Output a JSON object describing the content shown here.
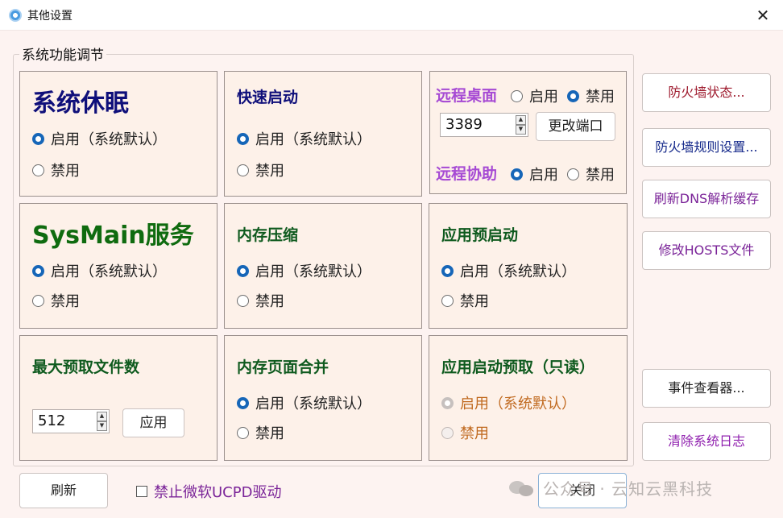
{
  "window": {
    "title": "其他设置",
    "close_glyph": "✕"
  },
  "group": {
    "legend": "系统功能调节"
  },
  "panels": {
    "sleep": {
      "title": "系统休眠",
      "option_on": "启用（系统默认）",
      "option_off": "禁用",
      "selected": "on"
    },
    "fastboot": {
      "title": "快速启动",
      "option_on": "启用（系统默认）",
      "option_off": "禁用",
      "selected": "on"
    },
    "sysmain": {
      "title": "SysMain服务",
      "option_on": "启用（系统默认）",
      "option_off": "禁用",
      "selected": "on"
    },
    "memcompress": {
      "title": "内存压缩",
      "option_on": "启用（系统默认）",
      "option_off": "禁用",
      "selected": "on"
    },
    "apppreload": {
      "title": "应用预启动",
      "option_on": "启用（系统默认）",
      "option_off": "禁用",
      "selected": "on"
    },
    "prefetch": {
      "title": "最大预取文件数",
      "value": "512",
      "apply_label": "应用"
    },
    "pagecombine": {
      "title": "内存页面合并",
      "option_on": "启用（系统默认）",
      "option_off": "禁用",
      "selected": "on"
    },
    "launchprefetch": {
      "title": "应用启动预取（只读）",
      "option_on": "启用（系统默认）",
      "option_off": "禁用",
      "selected": "on",
      "disabled": true
    }
  },
  "remote": {
    "desktop_label": "远程桌面",
    "desktop_on": "启用",
    "desktop_off": "禁用",
    "desktop_selected": "off",
    "port_value": "3389",
    "change_port_label": "更改端口",
    "assist_label": "远程协助",
    "assist_on": "启用",
    "assist_off": "禁用",
    "assist_selected": "on"
  },
  "side_buttons": {
    "firewall_status": "防火墙状态...",
    "firewall_rules": "防火墙规则设置...",
    "flush_dns": "刷新DNS解析缓存",
    "edit_hosts": "修改HOSTS文件",
    "event_viewer": "事件查看器...",
    "clear_logs": "清除系统日志"
  },
  "footer": {
    "refresh_label": "刷新",
    "ucpd_label": "禁止微软UCPD驱动",
    "ucpd_checked": false,
    "close_label": "关闭"
  },
  "watermark": {
    "text": "公众号 · 云知云黑科技"
  },
  "colors": {
    "background": "#fdf3f1",
    "panel": "#fdf1e9",
    "radio_selected": "#1666b8",
    "title_navy": "#0f0f7a",
    "title_green": "#0f6b0f",
    "title_purple": "#a64ad4"
  }
}
